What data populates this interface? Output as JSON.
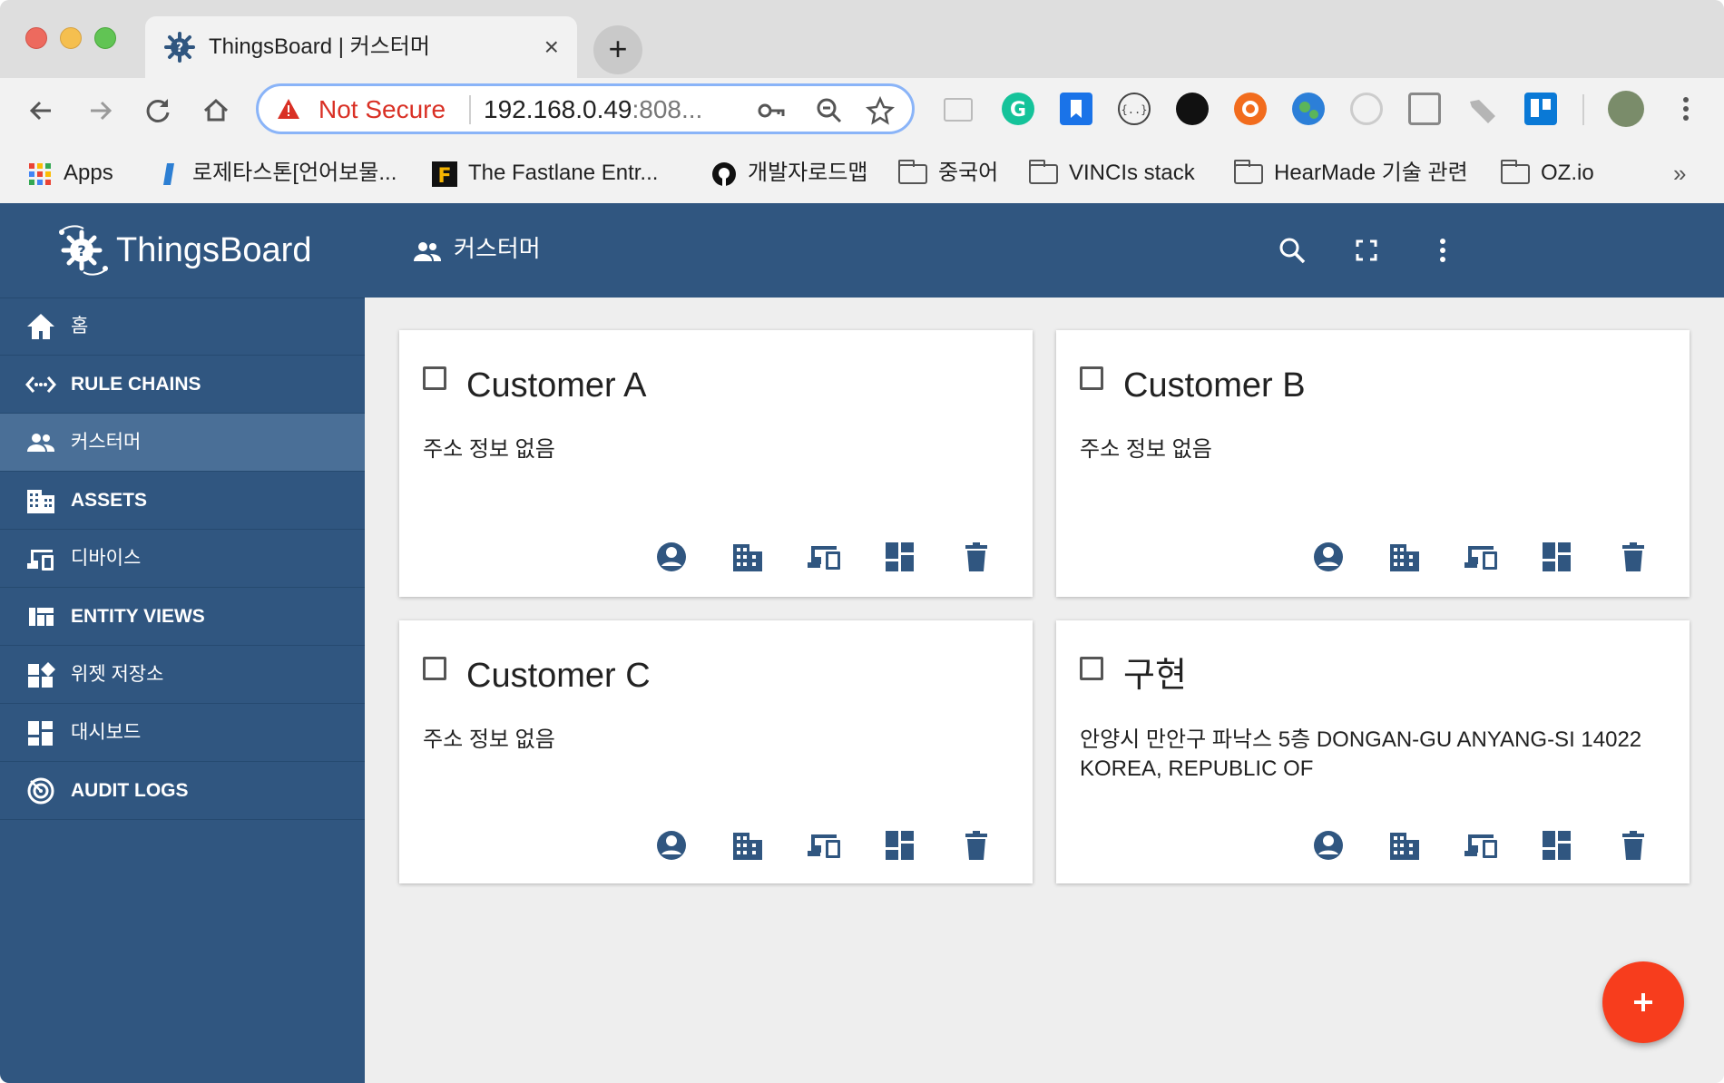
{
  "browser": {
    "tab_title": "ThingsBoard | 커스터머",
    "tab_close": "×",
    "new_tab": "+",
    "security_label": "Not Secure",
    "url": "192.168.0.49",
    "url_port": ":808..."
  },
  "bookmarks": [
    {
      "label": "Apps",
      "icon": "apps-grid-icon"
    },
    {
      "label": "로제타스톤[언어보물...",
      "icon": "rosetta-icon"
    },
    {
      "label": "The Fastlane Entr...",
      "icon": "fastlane-icon"
    },
    {
      "label": "개발자로드맵",
      "icon": "github-icon"
    },
    {
      "label": "중국어",
      "icon": "folder-icon"
    },
    {
      "label": "VINCIs stack",
      "icon": "folder-icon"
    },
    {
      "label": "HearMade 기술 관련",
      "icon": "folder-icon"
    },
    {
      "label": "OZ.io",
      "icon": "folder-icon"
    }
  ],
  "bookmarks_more": "»",
  "sidebar": {
    "brand": "ThingsBoard",
    "items": [
      {
        "label": "홈",
        "icon": "home-icon"
      },
      {
        "label": "RULE CHAINS",
        "icon": "rule-chains-icon"
      },
      {
        "label": "커스터머",
        "icon": "customers-icon"
      },
      {
        "label": "ASSETS",
        "icon": "assets-icon"
      },
      {
        "label": "디바이스",
        "icon": "devices-icon"
      },
      {
        "label": "ENTITY VIEWS",
        "icon": "entity-views-icon"
      },
      {
        "label": "위젯 저장소",
        "icon": "widgets-icon"
      },
      {
        "label": "대시보드",
        "icon": "dashboards-icon"
      },
      {
        "label": "AUDIT LOGS",
        "icon": "audit-logs-icon"
      }
    ],
    "active_item": "커스터머"
  },
  "header": {
    "title": "커스터머"
  },
  "customers": [
    {
      "name": "Customer A",
      "address": "주소 정보 없음"
    },
    {
      "name": "Customer B",
      "address": "주소 정보 없음"
    },
    {
      "name": "Customer C",
      "address": "주소 정보 없음"
    },
    {
      "name": "구현",
      "address": "안양시 만안구 파낙스 5층 DONGAN-GU ANYANG-SI 14022 KOREA, REPUBLIC OF"
    }
  ],
  "card_actions": [
    "manage-users-icon",
    "manage-assets-icon",
    "manage-devices-icon",
    "manage-dashboards-icon",
    "delete-icon"
  ],
  "colors": {
    "primary": "#305680",
    "active_item": "#4a6f97",
    "fab": "#f73d1d",
    "not_secure": "#d93025"
  }
}
